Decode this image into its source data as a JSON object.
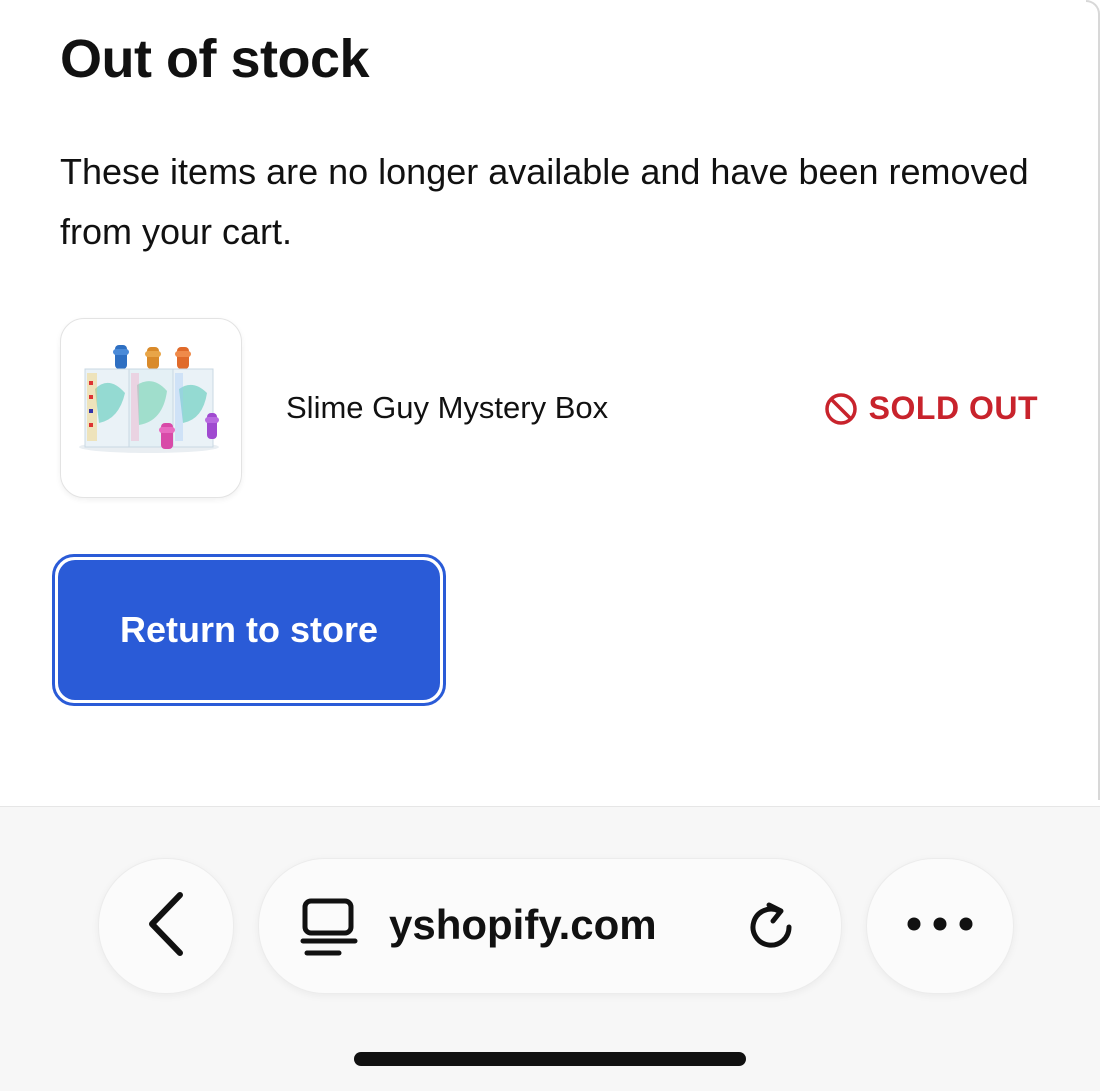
{
  "modal": {
    "title": "Out of stock",
    "message": "These items are no longer available and have been removed from your cart."
  },
  "item": {
    "name": "Slime Guy Mystery Box",
    "status": "SOLD OUT",
    "status_icon": "prohibited-icon",
    "status_color": "#c8232c",
    "thumbnail": "product-image"
  },
  "actions": {
    "return_label": "Return to store",
    "accent_color": "#2a5bd7"
  },
  "browser": {
    "url_text": "yshopify.com",
    "back_icon": "chevron-left-icon",
    "tabs_icon": "page-menu-icon",
    "reload_icon": "reload-icon",
    "more_icon": "more-icon"
  }
}
